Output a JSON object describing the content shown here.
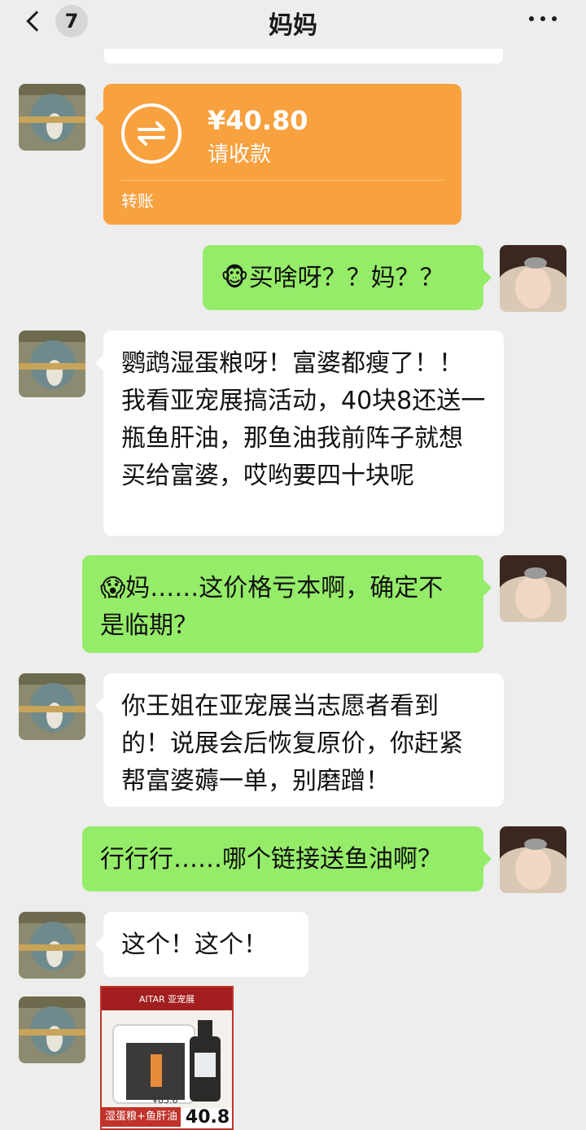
{
  "header": {
    "title": "妈妈",
    "unread_count": "7"
  },
  "transfer": {
    "amount": "¥40.80",
    "status": "请收款",
    "label": "转账"
  },
  "messages": [
    {
      "from": "me",
      "text": "🐵买啥呀？？妈？？"
    },
    {
      "from": "mom",
      "text": "鹦鹉湿蛋粮呀！富婆都瘦了！！我看亚宠展搞活动，40块8还送一瓶鱼肝油，那鱼油我前阵子就想买给富婆，哎哟要四十块呢"
    },
    {
      "from": "me",
      "text": "😱妈……这价格亏本啊，确定不是临期？"
    },
    {
      "from": "mom",
      "text": "你王姐在亚宠展当志愿者看到的！说展会后恢复原价，你赶紧帮富婆薅一单，别磨蹭！"
    },
    {
      "from": "me",
      "text": "行行行……哪个链接送鱼油啊？"
    },
    {
      "from": "mom",
      "text": "这个！这个！"
    }
  ],
  "product": {
    "brand": "AITAR 亚宠展",
    "name": "湿蛋粮+鱼肝油",
    "orig_price": "¥83.6",
    "price": "40.8"
  },
  "colors": {
    "bubble_out": "#95ec69",
    "bubble_in": "#ffffff",
    "transfer": "#f8a13f",
    "bg": "#ededed"
  },
  "icons": [
    "back-chevron-icon",
    "more-icon",
    "transfer-arrows-icon"
  ]
}
